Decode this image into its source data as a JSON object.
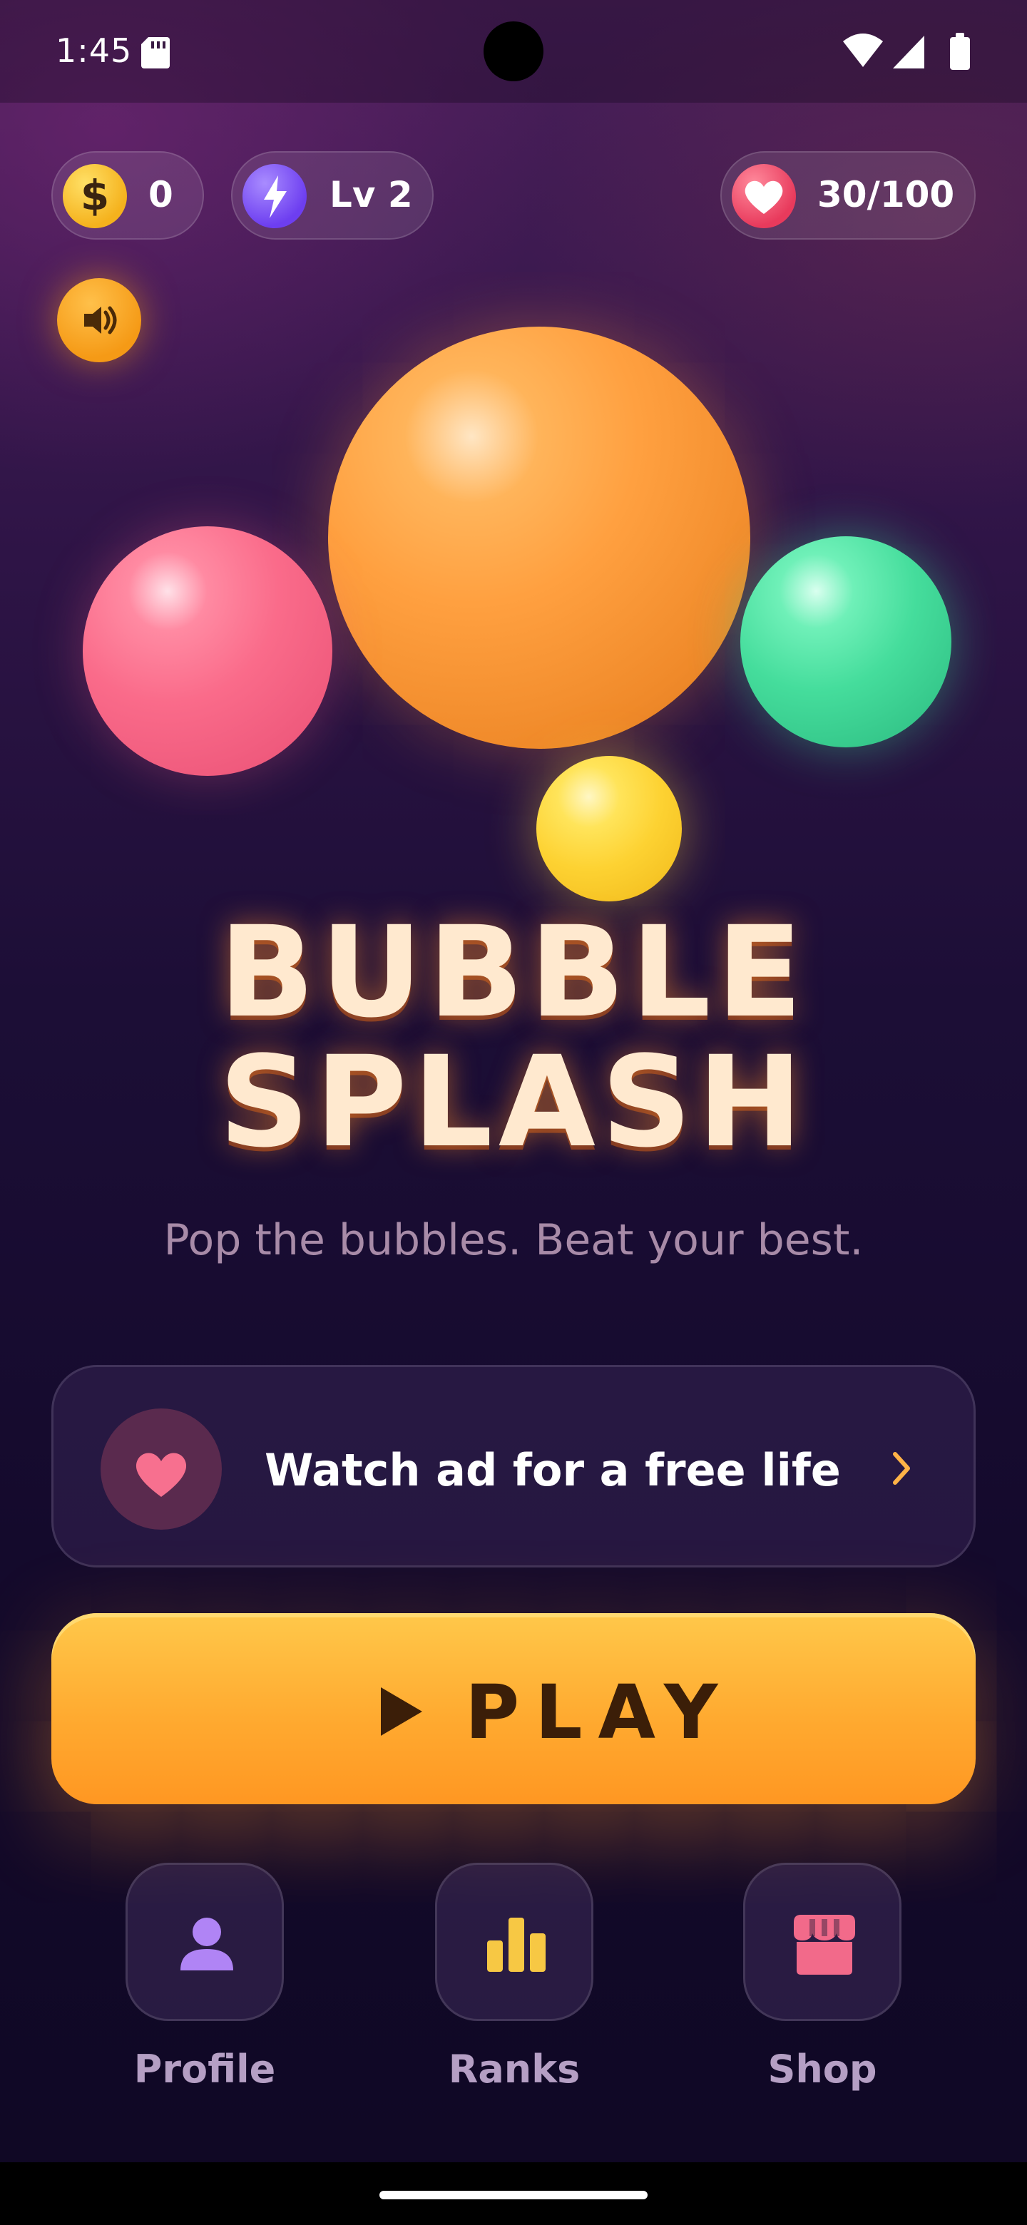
{
  "status_bar": {
    "time": "1:45"
  },
  "hud": {
    "coins": "0",
    "level": "Lv 2",
    "lives": "30/100"
  },
  "title": {
    "line1": "BUBBLE",
    "line2": "SPLASH"
  },
  "subtitle": "Pop the bubbles. Beat your best.",
  "ad_card": {
    "label": "Watch ad for a free life"
  },
  "play_button": {
    "label": "PLAY"
  },
  "nav": [
    {
      "label": "Profile",
      "icon": "person-icon",
      "color": "#b084f5"
    },
    {
      "label": "Ranks",
      "icon": "bar-chart-icon",
      "color": "#f7c844"
    },
    {
      "label": "Shop",
      "icon": "storefront-icon",
      "color": "#f26a8a"
    }
  ],
  "colors": {
    "accent_orange": "#ffaa30",
    "title_cream": "#ffe9cf",
    "background_top": "#4a1f5a",
    "background_bottom": "#0f0824"
  }
}
